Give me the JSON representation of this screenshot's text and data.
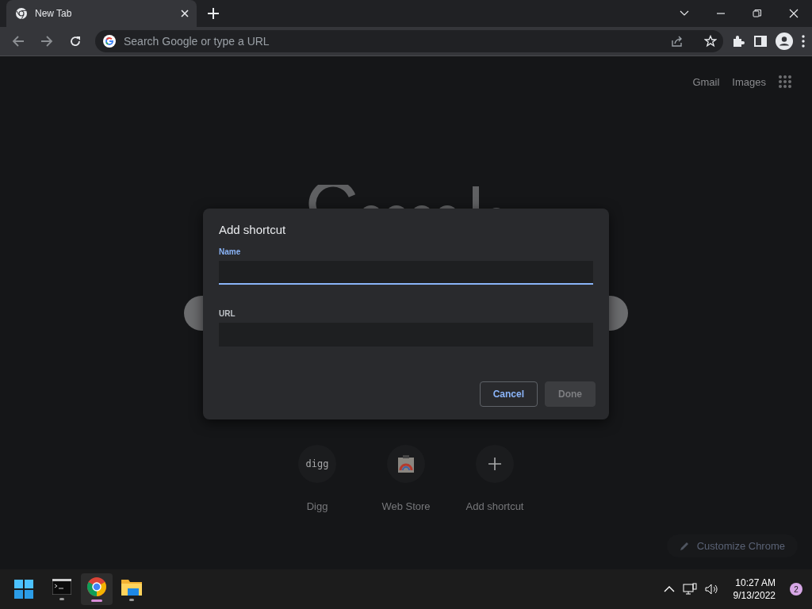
{
  "tabs": [
    {
      "title": "New Tab",
      "selected": true
    }
  ],
  "address_bar": {
    "placeholder": "Search Google or type a URL"
  },
  "top_links": [
    "Gmail",
    "Images"
  ],
  "shortcuts": [
    {
      "kind": "text",
      "icon_text": "digg",
      "label": "Digg"
    },
    {
      "kind": "store",
      "label": "Web Store"
    },
    {
      "kind": "add",
      "label": "Add shortcut"
    }
  ],
  "customize_button": "Customize Chrome",
  "dialog": {
    "title": "Add shortcut",
    "fields": [
      {
        "label": "Name",
        "focused": true
      },
      {
        "label": "URL",
        "focused": false
      }
    ],
    "buttons": [
      {
        "label": "Cancel",
        "disabled": false
      },
      {
        "label": "Done",
        "disabled": true
      }
    ]
  },
  "taskbar": {
    "apps": [
      {
        "kind": "terminal",
        "selected": false
      },
      {
        "kind": "chrome",
        "selected": true
      },
      {
        "kind": "folder",
        "selected": false
      }
    ],
    "time": "10:27 AM",
    "date": "9/13/2022",
    "notifications": "2"
  }
}
